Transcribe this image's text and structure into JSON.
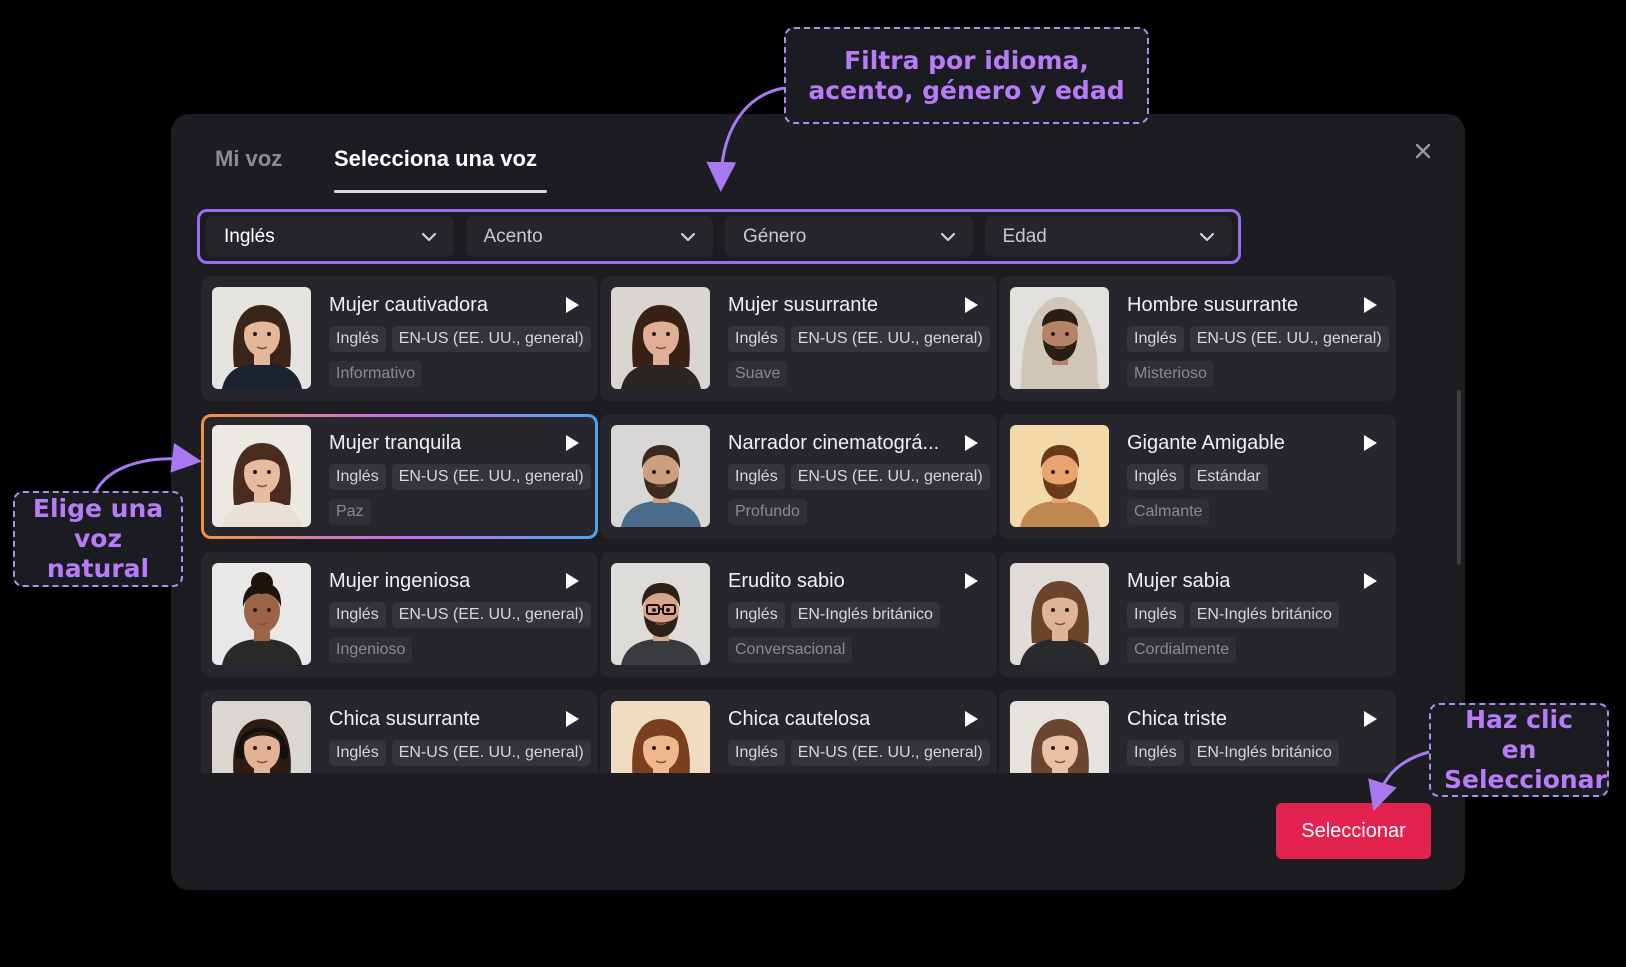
{
  "tabs": {
    "my_voice": "Mi voz",
    "select_voice": "Selecciona una voz"
  },
  "filters": [
    {
      "label": "Inglés",
      "selected": true
    },
    {
      "label": "Acento",
      "selected": false
    },
    {
      "label": "Género",
      "selected": false
    },
    {
      "label": "Edad",
      "selected": false
    }
  ],
  "voices": [
    {
      "name": "Mujer cautivadora",
      "tags": [
        "Inglés",
        "EN-US (EE. UU., general)"
      ],
      "style": "Informativo",
      "avatar": "woman-blazer"
    },
    {
      "name": "Mujer susurrante",
      "tags": [
        "Inglés",
        "EN-US (EE. UU., general)"
      ],
      "style": "Suave",
      "avatar": "woman-long-hair"
    },
    {
      "name": "Hombre susurrante",
      "tags": [
        "Inglés",
        "EN-US (EE. UU., general)"
      ],
      "style": "Misterioso",
      "avatar": "man-hoodie"
    },
    {
      "name": "Mujer tranquila",
      "tags": [
        "Inglés",
        "EN-US (EE. UU., general)"
      ],
      "style": "Paz",
      "avatar": "woman-calm",
      "selected": true
    },
    {
      "name": "Narrador cinematográ...",
      "tags": [
        "Inglés",
        "EN-US (EE. UU., general)"
      ],
      "style": "Profundo",
      "avatar": "man-denim"
    },
    {
      "name": "Gigante Amigable",
      "tags": [
        "Inglés",
        "Estándar"
      ],
      "style": "Calmante",
      "avatar": "cartoon-bearded-man"
    },
    {
      "name": "Mujer ingeniosa",
      "tags": [
        "Inglés",
        "EN-US (EE. UU., general)"
      ],
      "style": "Ingenioso",
      "avatar": "woman-curly-hair"
    },
    {
      "name": "Erudito sabio",
      "tags": [
        "Inglés",
        "EN-Inglés británico"
      ],
      "style": "Conversacional",
      "avatar": "man-glasses"
    },
    {
      "name": "Mujer sabia",
      "tags": [
        "Inglés",
        "EN-Inglés británico"
      ],
      "style": "Cordialmente",
      "avatar": "woman-middle-aged"
    },
    {
      "name": "Chica susurrante",
      "tags": [
        "Inglés",
        "EN-US (EE. UU., general)"
      ],
      "style": "",
      "avatar": "girl-headphones"
    },
    {
      "name": "Chica cautelosa",
      "tags": [
        "Inglés",
        "EN-US (EE. UU., general)"
      ],
      "style": "",
      "avatar": "cartoon-girl"
    },
    {
      "name": "Chica triste",
      "tags": [
        "Inglés",
        "EN-Inglés británico"
      ],
      "style": "",
      "avatar": "girl-sad"
    }
  ],
  "select_button": "Seleccionar",
  "close_icon": "close-icon",
  "callouts": {
    "filter": "Filtra por idioma, acento, género y edad",
    "voice": "Elige una voz natural",
    "select": "Haz clic en Seleccionar"
  },
  "colors": {
    "accent": "#9a6cf0",
    "callout_text": "#b77cf7",
    "primary_button": "#e4224f",
    "selected_border_start": "#f5913b",
    "selected_border_end": "#4aa4f5"
  }
}
